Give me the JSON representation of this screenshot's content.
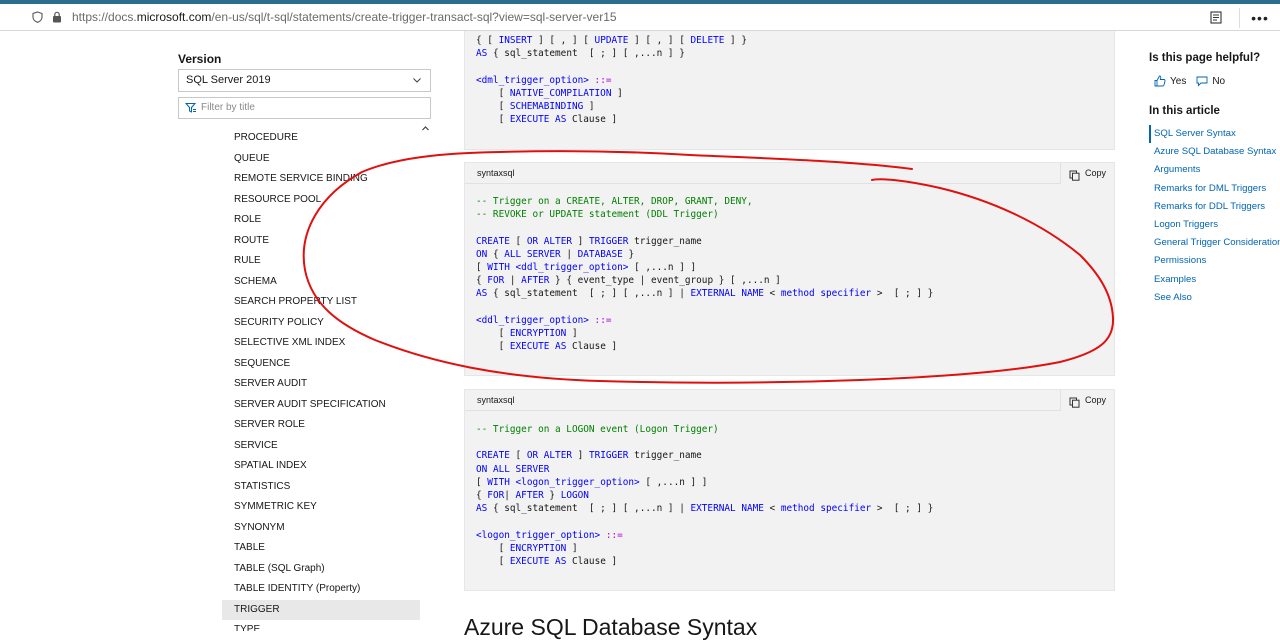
{
  "browser": {
    "url_prefix": "https://docs.",
    "url_domain": "microsoft.com",
    "url_suffix": "/en-us/sql/t-sql/statements/create-trigger-transact-sql?view=sql-server-ver15",
    "more_label": "•••"
  },
  "sidebar": {
    "version_label": "Version",
    "version_selected": "SQL Server 2019",
    "filter_placeholder": "Filter by title",
    "items": [
      {
        "label": "PROCEDURE"
      },
      {
        "label": "QUEUE"
      },
      {
        "label": "REMOTE SERVICE BINDING"
      },
      {
        "label": "RESOURCE POOL"
      },
      {
        "label": "ROLE"
      },
      {
        "label": "ROUTE"
      },
      {
        "label": "RULE"
      },
      {
        "label": "SCHEMA"
      },
      {
        "label": "SEARCH PROPERTY LIST"
      },
      {
        "label": "SECURITY POLICY"
      },
      {
        "label": "SELECTIVE XML INDEX"
      },
      {
        "label": "SEQUENCE"
      },
      {
        "label": "SERVER AUDIT"
      },
      {
        "label": "SERVER AUDIT SPECIFICATION"
      },
      {
        "label": "SERVER ROLE"
      },
      {
        "label": "SERVICE"
      },
      {
        "label": "SPATIAL INDEX"
      },
      {
        "label": "STATISTICS"
      },
      {
        "label": "SYMMETRIC KEY"
      },
      {
        "label": "SYNONYM"
      },
      {
        "label": "TABLE"
      },
      {
        "label": "TABLE (SQL Graph)"
      },
      {
        "label": "TABLE IDENTITY (Property)"
      },
      {
        "label": "TRIGGER"
      },
      {
        "label": "TYPE"
      }
    ],
    "active_item": "TRIGGER"
  },
  "code_blocks": [
    {
      "lang": "",
      "copy_label": "",
      "lines": [
        "{ [ INSERT ] [ , ] [ UPDATE ] [ , ] [ DELETE ] }",
        "AS { sql_statement  [ ; ] [ ,...n ] }",
        "",
        "<dml_trigger_option> ::=",
        "    [ NATIVE_COMPILATION ]",
        "    [ SCHEMABINDING ]",
        "    [ EXECUTE AS Clause ]"
      ]
    },
    {
      "lang": "syntaxsql",
      "copy_label": "Copy",
      "lines": [
        "-- Trigger on a CREATE, ALTER, DROP, GRANT, DENY,",
        "-- REVOKE or UPDATE statement (DDL Trigger)",
        "",
        "CREATE [ OR ALTER ] TRIGGER trigger_name",
        "ON { ALL SERVER | DATABASE }",
        "[ WITH <ddl_trigger_option> [ ,...n ] ]",
        "{ FOR | AFTER } { event_type | event_group } [ ,...n ]",
        "AS { sql_statement  [ ; ] [ ,...n ] | EXTERNAL NAME < method specifier >  [ ; ] }",
        "",
        "<ddl_trigger_option> ::=",
        "    [ ENCRYPTION ]",
        "    [ EXECUTE AS Clause ]"
      ]
    },
    {
      "lang": "syntaxsql",
      "copy_label": "Copy",
      "lines": [
        "-- Trigger on a LOGON event (Logon Trigger)",
        "",
        "CREATE [ OR ALTER ] TRIGGER trigger_name",
        "ON ALL SERVER",
        "[ WITH <logon_trigger_option> [ ,...n ] ]",
        "{ FOR| AFTER } LOGON",
        "AS { sql_statement  [ ; ] [ ,...n ] | EXTERNAL NAME < method specifier >  [ ; ] }",
        "",
        "<logon_trigger_option> ::=",
        "    [ ENCRYPTION ]",
        "    [ EXECUTE AS Clause ]"
      ]
    }
  ],
  "main": {
    "section_title": "Azure SQL Database Syntax"
  },
  "right_rail": {
    "helpful_title": "Is this page helpful?",
    "yes_label": "Yes",
    "no_label": "No",
    "in_article_title": "In this article",
    "links": [
      {
        "label": "SQL Server Syntax",
        "active": true
      },
      {
        "label": "Azure SQL Database Syntax"
      },
      {
        "label": "Arguments"
      },
      {
        "label": "Remarks for DML Triggers"
      },
      {
        "label": "Remarks for DDL Triggers"
      },
      {
        "label": "Logon Triggers"
      },
      {
        "label": "General Trigger Considerations"
      },
      {
        "label": "Permissions"
      },
      {
        "label": "Examples"
      },
      {
        "label": "See Also"
      }
    ]
  },
  "colors": {
    "keyword": "#0101fd",
    "comment": "#008000",
    "link": "#0065b3",
    "annotation": "#e0100f"
  }
}
